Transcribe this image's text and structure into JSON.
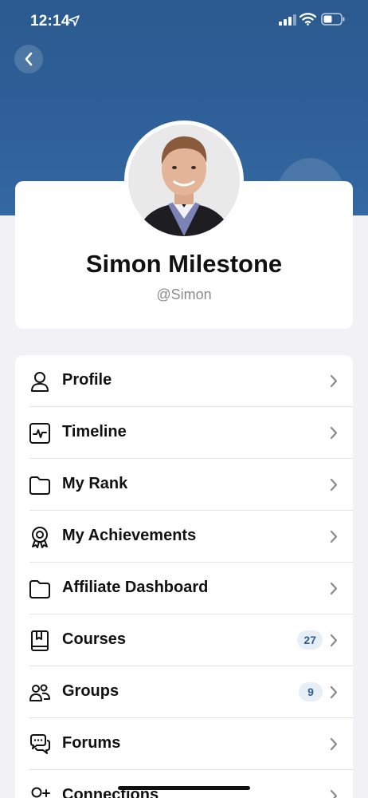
{
  "status_bar": {
    "time": "12:14",
    "location_icon": "location-arrow-icon",
    "signal_icon": "cellular-signal-icon",
    "wifi_icon": "wifi-icon",
    "battery_icon": "battery-icon"
  },
  "header": {
    "back_icon": "chevron-left-icon",
    "color": "#2f609a"
  },
  "profile": {
    "name": "Simon Milestone",
    "handle": "@Simon"
  },
  "menu": {
    "items": [
      {
        "label": "Profile",
        "icon": "user-icon"
      },
      {
        "label": "Timeline",
        "icon": "activity-icon"
      },
      {
        "label": "My Rank",
        "icon": "folder-icon"
      },
      {
        "label": "My Achievements",
        "icon": "award-icon"
      },
      {
        "label": "Affiliate Dashboard",
        "icon": "folder-icon"
      },
      {
        "label": "Courses",
        "icon": "book-icon",
        "badge": "27"
      },
      {
        "label": "Groups",
        "icon": "groups-icon",
        "badge": "9"
      },
      {
        "label": "Forums",
        "icon": "chat-bubbles-icon"
      },
      {
        "label": "Connections",
        "icon": "user-plus-icon"
      }
    ]
  },
  "colors": {
    "accent": "#2f609a",
    "badge_bg": "#e8eef6",
    "badge_text": "#2f5f95"
  }
}
